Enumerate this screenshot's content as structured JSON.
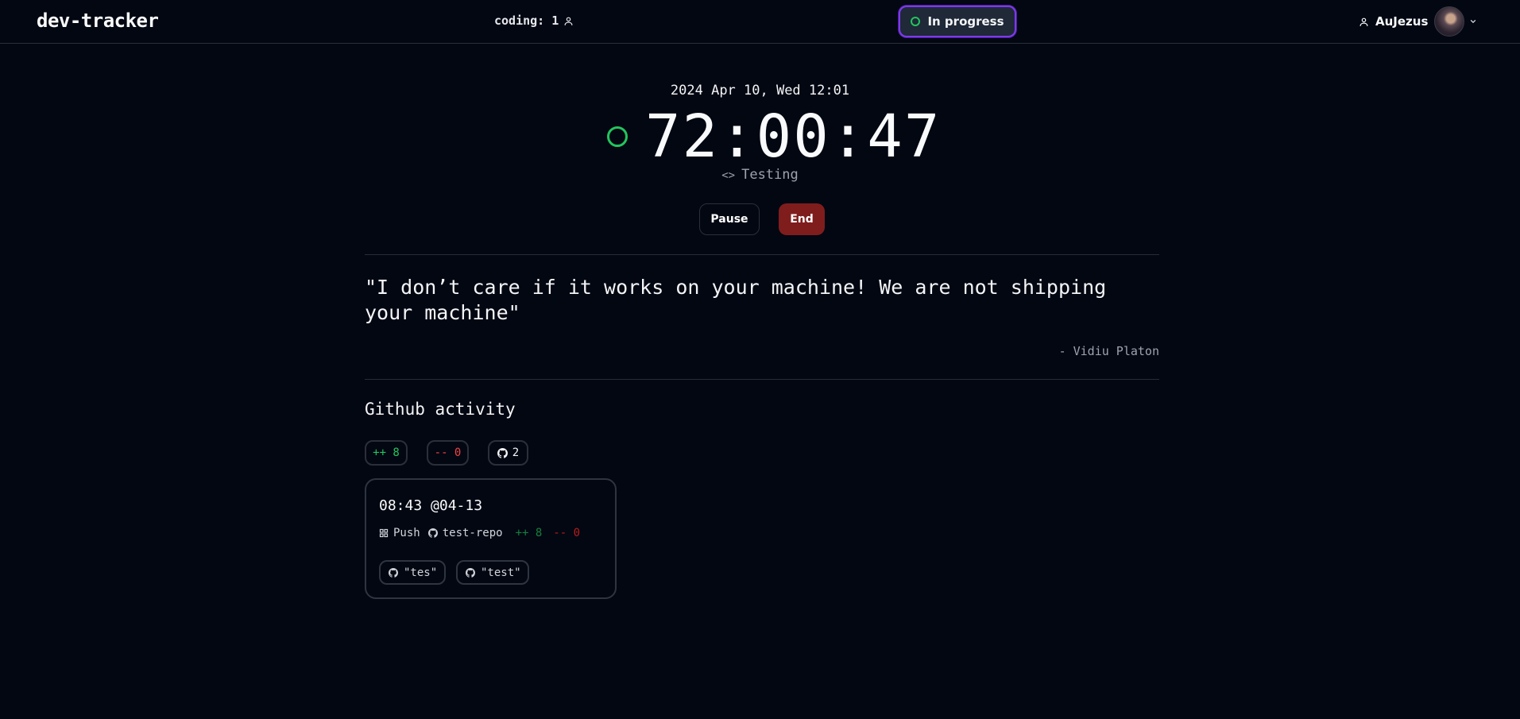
{
  "header": {
    "logo": "dev-tracker",
    "coding_label": "coding: 1",
    "status_label": "In progress",
    "username": "AuJezus"
  },
  "timer": {
    "datetime": "2024 Apr 10, Wed 12:01",
    "elapsed": "72:00:47",
    "task_icon": "<>",
    "task": "Testing",
    "pause_label": "Pause",
    "end_label": "End"
  },
  "quote": {
    "text": "\"I don’t care if it works on your machine! We are not shipping your machine\"",
    "author": "- Vidiu Platon"
  },
  "github": {
    "title": "Github activity",
    "additions": "++ 8",
    "deletions": "-- 0",
    "commits": "2",
    "events": [
      {
        "time": "08:43 @04-13",
        "type": "Push",
        "repo": "test-repo",
        "additions": "++ 8",
        "deletions": "-- 0",
        "commits": [
          "\"tes\"",
          "\"test\""
        ]
      }
    ]
  },
  "colors": {
    "background": "#030712",
    "accent": "#7c3aed",
    "active_green": "#22c55e",
    "end_red": "#7f1d1d",
    "deletion_red": "#ef4444"
  },
  "icons": {
    "coding": "user-icon",
    "status": "circle-icon",
    "user": "user-icon",
    "task": "code-icon",
    "commits": "github-icon",
    "event_type": "grid-icon"
  }
}
